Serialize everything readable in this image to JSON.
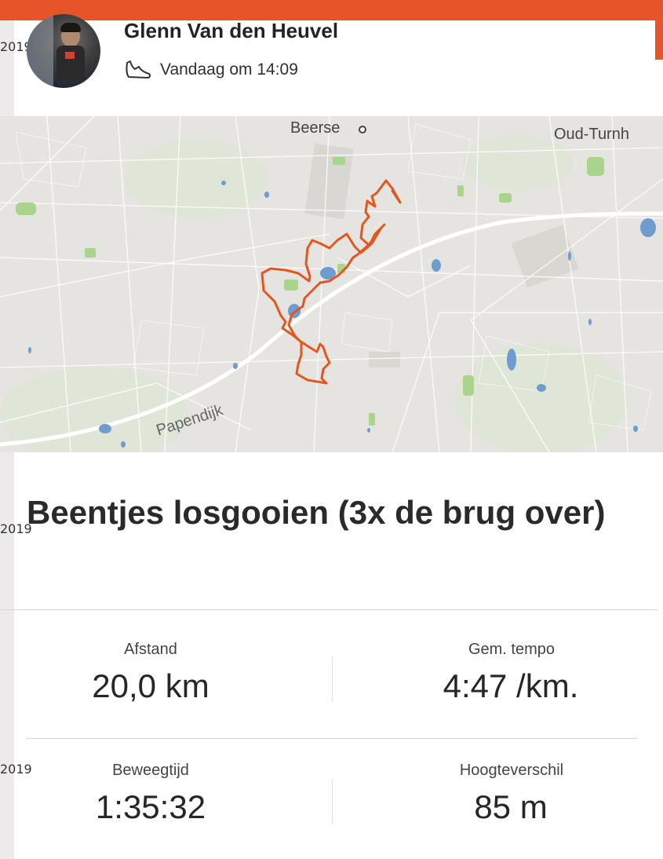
{
  "side_stamps": [
    "2019",
    "2019",
    "2019"
  ],
  "user": {
    "name": "Glenn Van den Heuvel",
    "timestamp": "Vandaag om 14:09"
  },
  "map": {
    "labels": {
      "town1": "Beerse",
      "town2": "Oud-Turnh",
      "road": "Papendijk"
    },
    "route_color": "#e4561f"
  },
  "activity": {
    "title": "Beentjes losgooien (3x de brug over)"
  },
  "stats": [
    {
      "label": "Afstand",
      "value": "20,0 km"
    },
    {
      "label": "Gem. tempo",
      "value": "4:47 /km."
    },
    {
      "label": "Beweegtijd",
      "value": "1:35:32"
    },
    {
      "label": "Hoogteverschil",
      "value": "85 m"
    }
  ],
  "colors": {
    "accent": "#e8542a"
  }
}
